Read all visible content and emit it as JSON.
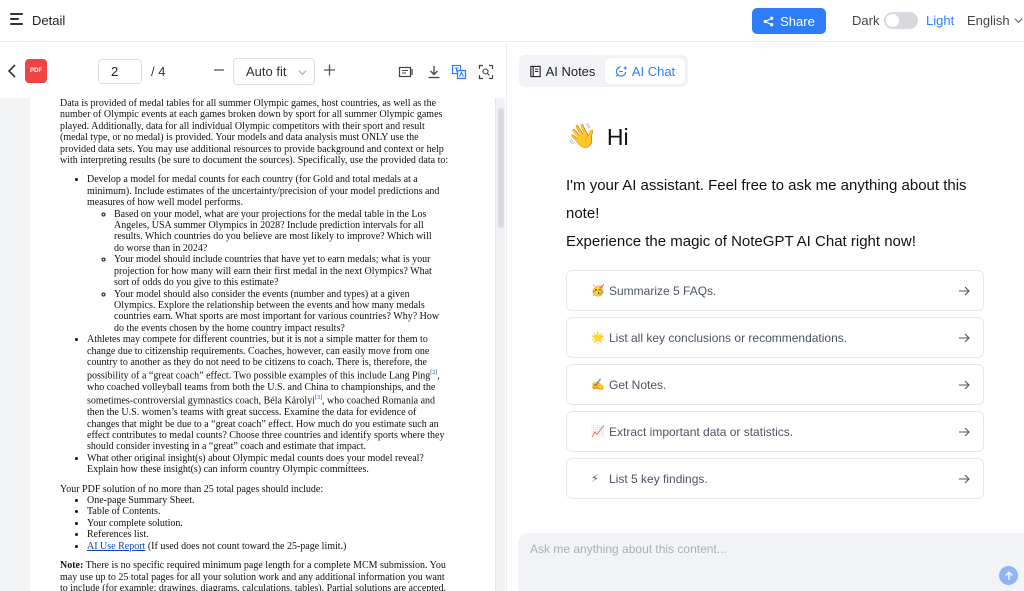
{
  "header": {
    "title": "Detail",
    "share_label": "Share",
    "theme_dark": "Dark",
    "theme_light": "Light",
    "language": "English"
  },
  "toolbar": {
    "pdf_badge": "PDF",
    "page_current": "2",
    "page_total": "/ 4",
    "zoom_mode": "Auto fit"
  },
  "document": {
    "intro_lines": [
      "Data is provided of medal tables for all summer Olympic games, host countries, as well as the",
      "number of Olympic events at each games broken down by sport for all summer Olympic games",
      "played. Additionally, data for all individual Olympic competitors with their sport and result",
      "(medal type, or no medal) is provided. Your models and data analysis must ONLY use the",
      "provided data sets. You may use additional resources to provide background and context or help",
      "with interpreting results (be sure to document the sources). Specifically, use the provided data to:"
    ],
    "bullet1_lines": [
      "Develop a model for medal counts for each country (for Gold and total medals at a",
      "minimum). Include estimates of the uncertainty/precision of your model predictions and",
      "measures of how well model performs."
    ],
    "sub1_lines": [
      "Based on your model, what are your projections for the medal table in the Los",
      "Angeles, USA summer Olympics in 2028? Include prediction intervals for all",
      "results. Which countries do you believe are most likely to improve? Which will",
      "do worse than in 2024?"
    ],
    "sub2_lines": [
      "Your model should include countries that have yet to earn medals; what is your",
      "projection for how many will earn their first medal in the next Olympics? What",
      "sort of odds do you give to this estimate?"
    ],
    "sub3_lines": [
      "Your model should also consider the events (number and types) at a given",
      "Olympics. Explore the relationship between the events and how many medals",
      "countries earn. What sports are most important for various countries? Why? How",
      "do the events chosen by the home country impact results?"
    ],
    "bullet2_a": [
      "Athletes may compete for different countries, but it is not a simple matter for them to",
      "change due to citizenship requirements. Coaches, however, can easily move from one",
      "country to another as they do not need to be citizens to coach. There is, therefore, the"
    ],
    "bullet2_b1": "possibility of a “great coach” effect. Two possible examples of this include Lang Ping",
    "bullet2_sup1": "[2]",
    "bullet2_b2": ",",
    "bullet2_c": "who coached volleyball teams from both the U.S. and China to championships, and the",
    "bullet2_d1": "sometimes-controversial gymnastics coach, Béla Károlyi",
    "bullet2_sup2": "[3]",
    "bullet2_d2": ", who coached Romania and",
    "bullet2_e": [
      "then the U.S. women’s teams with great success. Examine the data for evidence of",
      "changes that might be due to a “great coach” effect. How much do you estimate such an",
      "effect contributes to medal counts? Choose three countries and identify sports where they",
      "should consider investing in a “great” coach and estimate that impact."
    ],
    "bullet3_lines": [
      "What other original insight(s) about Olympic medal counts does your model reveal?",
      "Explain how these insight(s) can inform country Olympic committees."
    ],
    "solution_heading": "Your PDF solution of no more than 25 total pages should include:",
    "solution_items": [
      "One-page Summary Sheet.",
      "Table of Contents.",
      "Your complete solution.",
      "References list."
    ],
    "ai_report_link": "AI Use Report",
    "ai_report_note": " (If used does not count toward the 25-page limit.)",
    "note_label": "Note:",
    "note_lines": [
      " There is no specific required minimum page length for a complete MCM submission. You",
      "may use up to 25 total pages for all your solution work and any additional information you want",
      "to include (for example: drawings, diagrams, calculations, tables). Partial solutions are accepted."
    ]
  },
  "right_panel": {
    "tab_notes": "AI Notes",
    "tab_chat": "AI Chat",
    "greeting_emoji": "👋",
    "greeting": "Hi",
    "intro_line1": "I'm your AI assistant. Feel free to ask me anything about this note!",
    "intro_line2": "Experience the magic of NoteGPT AI Chat right now!",
    "suggestions": [
      {
        "emoji": "🥳",
        "label": "Summarize 5 FAQs."
      },
      {
        "emoji": "🌟",
        "label": "List all key conclusions or recommendations."
      },
      {
        "emoji": "✍️",
        "label": "Get Notes."
      },
      {
        "emoji": "📈",
        "label": "Extract important data or statistics."
      },
      {
        "emoji": "⚡",
        "label": "List 5 key findings."
      }
    ],
    "chat_placeholder": "Ask me anything about this content..."
  },
  "colors": {
    "accent": "#2f7df6",
    "pdf_red": "#ef4444"
  }
}
